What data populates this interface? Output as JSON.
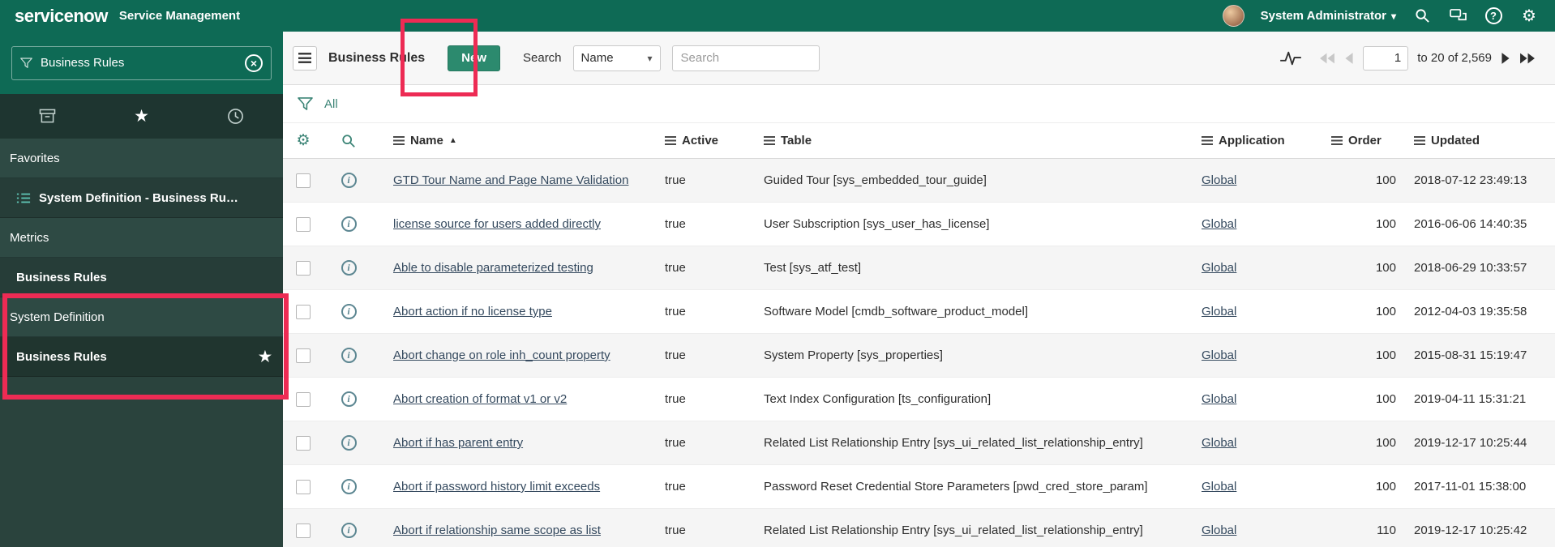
{
  "colors": {
    "header_bg": "#0e6a55",
    "sidebar_bg": "#2a433d",
    "accent_teal": "#3d8577",
    "new_button": "#2c8a6e",
    "annotation_red": "#ed2b54",
    "link": "#34495e"
  },
  "icons": {
    "gear": "⚙",
    "caret_down": "▾",
    "sort_asc": "▲",
    "star": "★",
    "close_x": "×",
    "info": "i",
    "help": "?"
  },
  "header": {
    "logo": "servicenow",
    "product": "Service Management",
    "user": "System Administrator"
  },
  "sidebar": {
    "search": {
      "value": "Business Rules"
    },
    "sections": [
      {
        "label": "Favorites",
        "items": [
          {
            "label": "System Definition - Business Ru…"
          }
        ]
      },
      {
        "label": "Metrics",
        "items": [
          {
            "label": "Business Rules"
          }
        ]
      },
      {
        "label": "System Definition",
        "items": [
          {
            "label": "Business Rules",
            "starred": true
          }
        ]
      }
    ]
  },
  "toolbar": {
    "title": "Business Rules",
    "new_label": "New",
    "search_label": "Search",
    "search_field": "Name",
    "search_placeholder": "Search"
  },
  "pagination": {
    "page": "1",
    "range": "to 20 of 2,569"
  },
  "filter": {
    "all_label": "All"
  },
  "table": {
    "columns": [
      "Name",
      "Active",
      "Table",
      "Application",
      "Order",
      "Updated"
    ],
    "rows": [
      {
        "name": "GTD Tour Name and Page Name Validation",
        "active": "true",
        "table": "Guided Tour [sys_embedded_tour_guide]",
        "application": "Global",
        "order": "100",
        "updated": "2018-07-12 23:49:13"
      },
      {
        "name": "license source for users added directly",
        "active": "true",
        "table": "User Subscription [sys_user_has_license]",
        "application": "Global",
        "order": "100",
        "updated": "2016-06-06 14:40:35"
      },
      {
        "name": "Able to disable parameterized testing",
        "active": "true",
        "table": "Test [sys_atf_test]",
        "application": "Global",
        "order": "100",
        "updated": "2018-06-29 10:33:57"
      },
      {
        "name": "Abort action if no license type",
        "active": "true",
        "table": "Software Model [cmdb_software_product_model]",
        "application": "Global",
        "order": "100",
        "updated": "2012-04-03 19:35:58"
      },
      {
        "name": "Abort change on role inh_count property",
        "active": "true",
        "table": "System Property [sys_properties]",
        "application": "Global",
        "order": "100",
        "updated": "2015-08-31 15:19:47"
      },
      {
        "name": "Abort creation of format v1 or v2",
        "active": "true",
        "table": "Text Index Configuration [ts_configuration]",
        "application": "Global",
        "order": "100",
        "updated": "2019-04-11 15:31:21"
      },
      {
        "name": "Abort if has parent entry",
        "active": "true",
        "table": "Related List Relationship Entry [sys_ui_related_list_relationship_entry]",
        "application": "Global",
        "order": "100",
        "updated": "2019-12-17 10:25:44"
      },
      {
        "name": "Abort if password history limit exceeds",
        "active": "true",
        "table": "Password Reset Credential Store Parameters [pwd_cred_store_param]",
        "application": "Global",
        "order": "100",
        "updated": "2017-11-01 15:38:00"
      },
      {
        "name": "Abort if relationship same scope as list",
        "active": "true",
        "table": "Related List Relationship Entry [sys_ui_related_list_relationship_entry]",
        "application": "Global",
        "order": "110",
        "updated": "2019-12-17 10:25:42"
      }
    ]
  }
}
